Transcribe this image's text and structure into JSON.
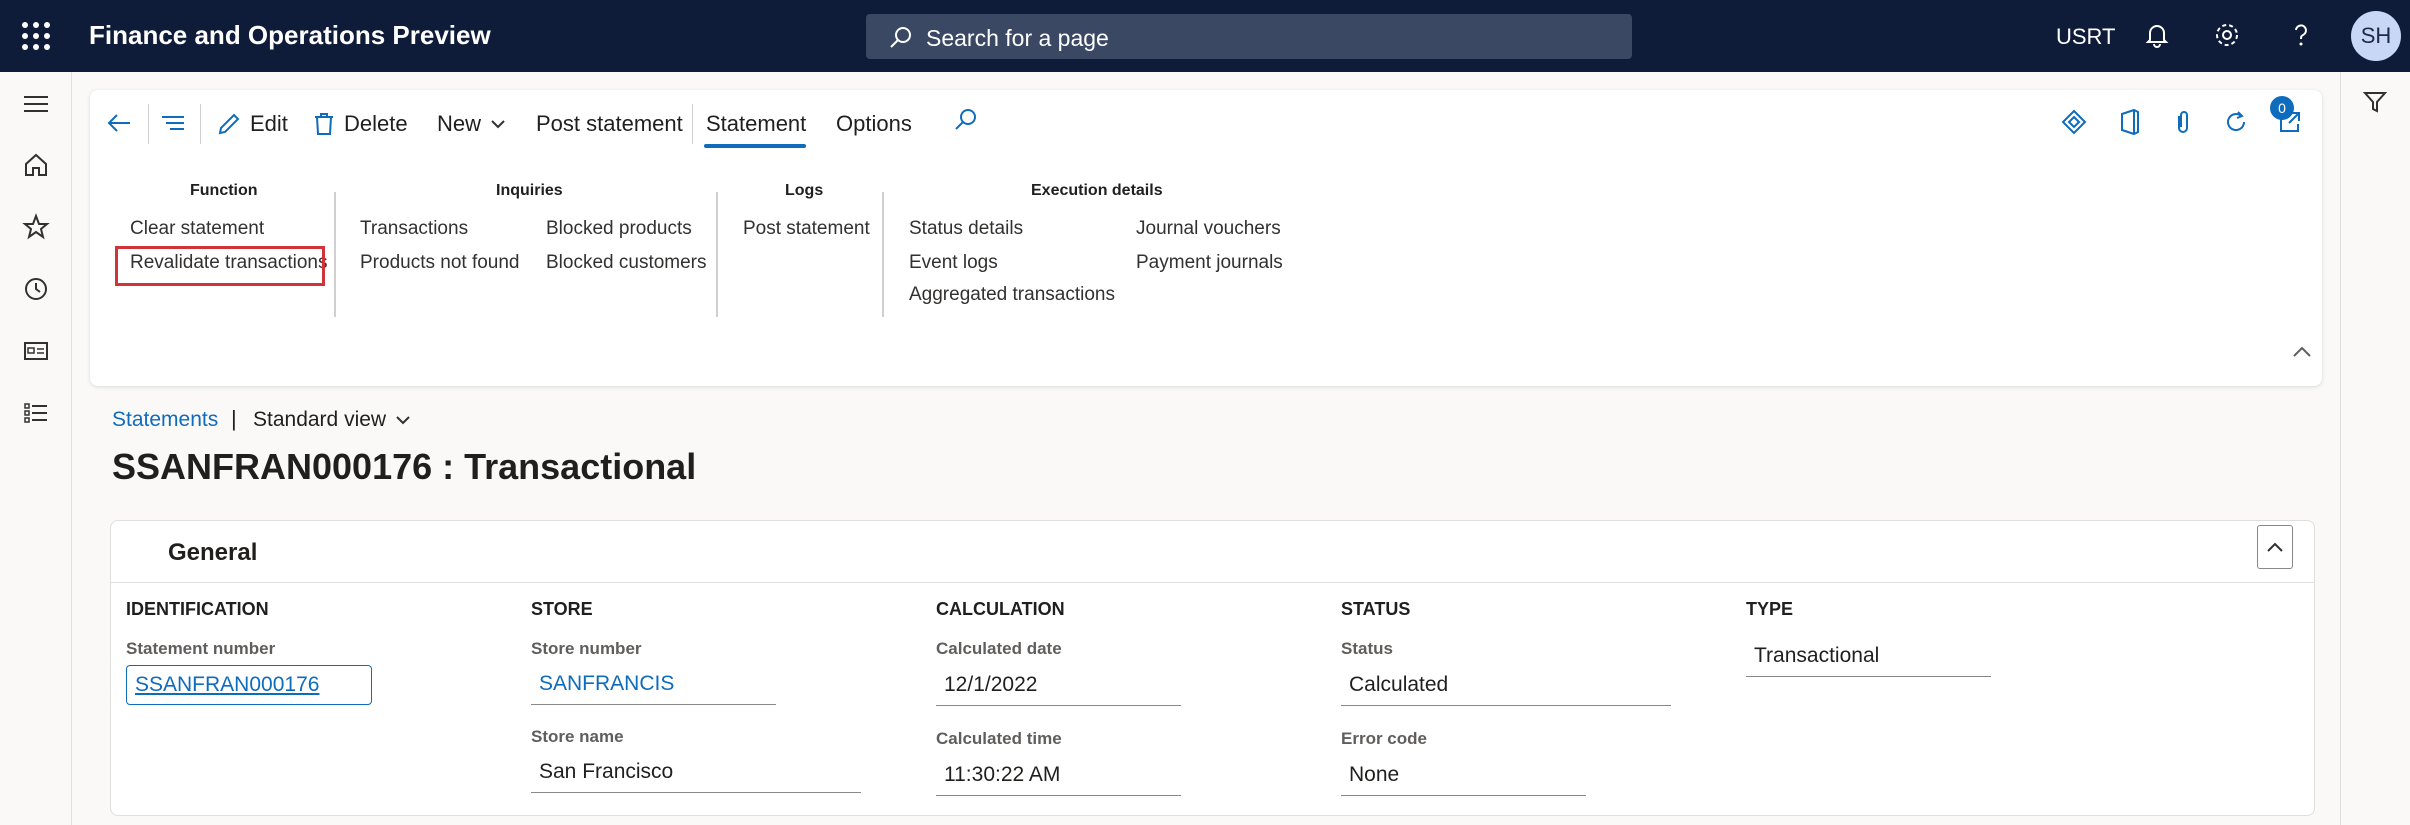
{
  "app": {
    "title": "Finance and Operations Preview",
    "search_placeholder": "Search for a page",
    "company": "USRT",
    "user_initials": "SH"
  },
  "actionbar": {
    "edit": "Edit",
    "delete": "Delete",
    "new": "New",
    "post_statement": "Post statement",
    "tabs": [
      "Statement",
      "Options"
    ],
    "active_tab": "Statement",
    "attachments_count": "0"
  },
  "ribbon": {
    "function": {
      "title": "Function",
      "items": [
        "Clear statement",
        "Revalidate transactions"
      ],
      "highlighted": "Revalidate transactions"
    },
    "inquiries": {
      "title": "Inquiries",
      "items": [
        "Transactions",
        "Products not found",
        "Blocked products",
        "Blocked customers"
      ]
    },
    "logs": {
      "title": "Logs",
      "items": [
        "Post statement"
      ]
    },
    "execution": {
      "title": "Execution details",
      "items": [
        "Status details",
        "Event logs",
        "Aggregated transactions",
        "Journal vouchers",
        "Payment journals"
      ]
    }
  },
  "page": {
    "breadcrumb": "Statements",
    "separator": "|",
    "view": "Standard view",
    "title": "SSANFRAN000176 : Transactional"
  },
  "general": {
    "title": "General",
    "identification": {
      "heading": "IDENTIFICATION",
      "statement_number_label": "Statement number",
      "statement_number": "SSANFRAN000176"
    },
    "store": {
      "heading": "STORE",
      "store_number_label": "Store number",
      "store_number": "SANFRANCIS",
      "store_name_label": "Store name",
      "store_name": "San Francisco"
    },
    "calculation": {
      "heading": "CALCULATION",
      "date_label": "Calculated date",
      "date": "12/1/2022",
      "time_label": "Calculated time",
      "time": "11:30:22 AM"
    },
    "status": {
      "heading": "STATUS",
      "status_label": "Status",
      "status": "Calculated",
      "error_label": "Error code",
      "error": "None"
    },
    "type": {
      "heading": "TYPE",
      "type": "Transactional"
    }
  },
  "colors": {
    "topbar": "#0f1c39",
    "accent": "#0f6cbd",
    "highlight_border": "#d13438"
  }
}
